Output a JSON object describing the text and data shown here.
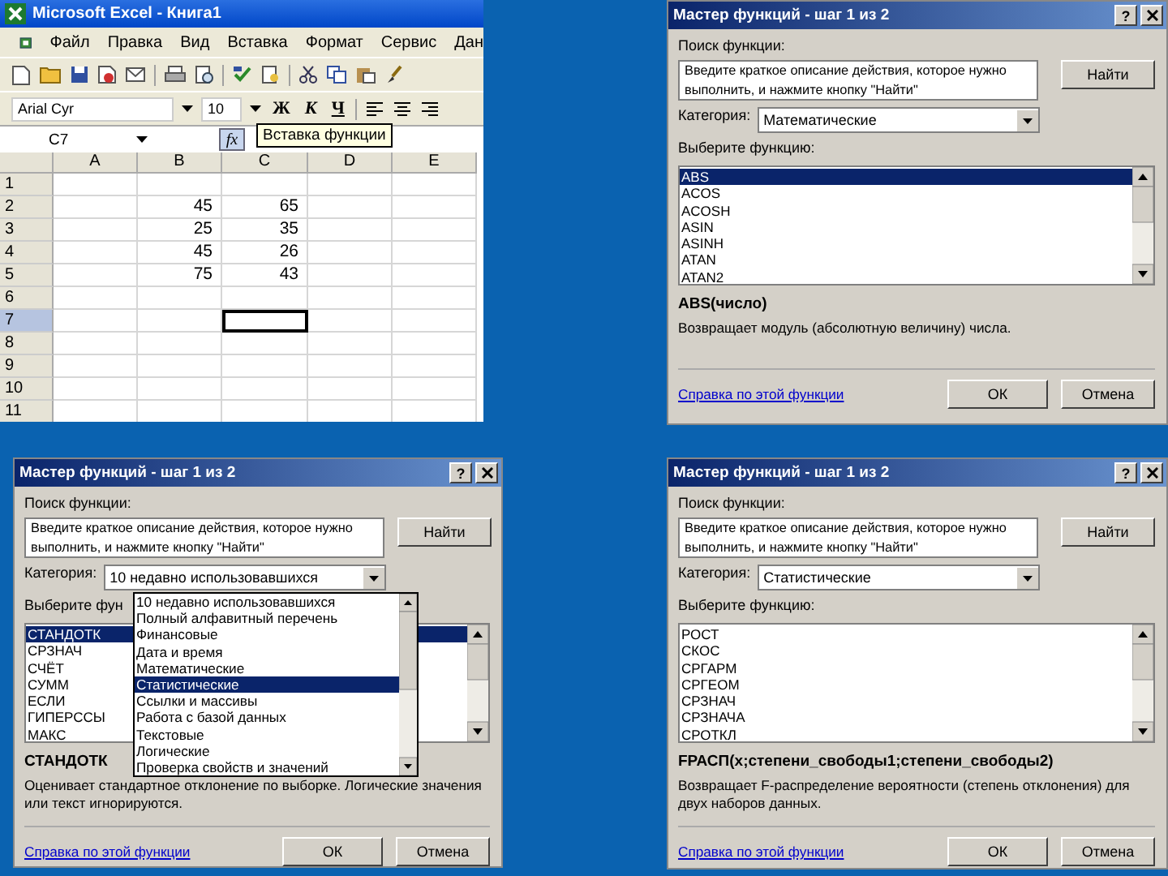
{
  "excel": {
    "title": "Microsoft Excel - Книга1",
    "menu": [
      "Файл",
      "Правка",
      "Вид",
      "Вставка",
      "Формат",
      "Сервис",
      "Дан"
    ],
    "font_name": "Arial Cyr",
    "font_size": "10",
    "format_buttons": [
      {
        "label": "Ж",
        "kind": "bold"
      },
      {
        "label": "К",
        "kind": "italic"
      },
      {
        "label": "Ч",
        "kind": "underline"
      }
    ],
    "name_box": "C7",
    "fx_button": "fx",
    "tooltip": "Вставка функции",
    "columns": [
      "A",
      "B",
      "C",
      "D",
      "E"
    ],
    "rows": [
      {
        "label": "1",
        "selected": false,
        "cells": [
          {
            "selected": false
          },
          {
            "selected": false
          },
          {
            "selected": false
          },
          {
            "selected": false
          },
          {
            "selected": false
          }
        ]
      },
      {
        "label": "2",
        "selected": false,
        "cells": [
          {
            "selected": false
          },
          {
            "text": "45",
            "selected": false
          },
          {
            "text": "65",
            "selected": false
          },
          {
            "selected": false
          },
          {
            "selected": false
          }
        ]
      },
      {
        "label": "3",
        "selected": false,
        "cells": [
          {
            "selected": false
          },
          {
            "text": "25",
            "selected": false
          },
          {
            "text": "35",
            "selected": false
          },
          {
            "selected": false
          },
          {
            "selected": false
          }
        ]
      },
      {
        "label": "4",
        "selected": false,
        "cells": [
          {
            "selected": false
          },
          {
            "text": "45",
            "selected": false
          },
          {
            "text": "26",
            "selected": false
          },
          {
            "selected": false
          },
          {
            "selected": false
          }
        ]
      },
      {
        "label": "5",
        "selected": false,
        "cells": [
          {
            "selected": false
          },
          {
            "text": "75",
            "selected": false
          },
          {
            "text": "43",
            "selected": false
          },
          {
            "selected": false
          },
          {
            "selected": false
          }
        ]
      },
      {
        "label": "6",
        "selected": false,
        "cells": [
          {
            "selected": false
          },
          {
            "selected": false
          },
          {
            "selected": false
          },
          {
            "selected": false
          },
          {
            "selected": false
          }
        ]
      },
      {
        "label": "7",
        "selected": true,
        "cells": [
          {
            "selected": false
          },
          {
            "selected": false
          },
          {
            "selected": true
          },
          {
            "selected": false
          },
          {
            "selected": false
          }
        ]
      },
      {
        "label": "8",
        "selected": false,
        "cells": [
          {
            "selected": false
          },
          {
            "selected": false
          },
          {
            "selected": false
          },
          {
            "selected": false
          },
          {
            "selected": false
          }
        ]
      },
      {
        "label": "9",
        "selected": false,
        "cells": [
          {
            "selected": false
          },
          {
            "selected": false
          },
          {
            "selected": false
          },
          {
            "selected": false
          },
          {
            "selected": false
          }
        ]
      },
      {
        "label": "10",
        "selected": false,
        "cells": [
          {
            "selected": false
          },
          {
            "selected": false
          },
          {
            "selected": false
          },
          {
            "selected": false
          },
          {
            "selected": false
          }
        ]
      },
      {
        "label": "11",
        "selected": false,
        "cells": [
          {
            "selected": false
          },
          {
            "selected": false
          },
          {
            "selected": false
          },
          {
            "selected": false
          },
          {
            "selected": false
          }
        ]
      }
    ]
  },
  "dialogs": [
    {
      "title": "Мастер функций - шаг 1 из 2",
      "help_button": "?",
      "search_label": "Поиск функции:",
      "search_text": "Введите краткое описание действия, которое нужно выполнить, и нажмите кнопку \"Найти\"",
      "find_button": "Найти",
      "category_label": "Категория:",
      "category_value": "Математические",
      "list_label": "Выберите функцию:",
      "functions": [
        {
          "name": "ABS",
          "selected": true
        },
        {
          "name": "ACOS",
          "selected": false
        },
        {
          "name": "ACOSH",
          "selected": false
        },
        {
          "name": "ASIN",
          "selected": false
        },
        {
          "name": "ASINH",
          "selected": false
        },
        {
          "name": "ATAN",
          "selected": false
        },
        {
          "name": "ATAN2",
          "selected": false
        }
      ],
      "signature": "ABS(число)",
      "description": "Возвращает модуль (абсолютную величину) числа.",
      "help_link": "Справка по этой функции",
      "ok_button": "ОК",
      "cancel_button": "Отмена"
    },
    {
      "title": "Мастер функций - шаг 1 из 2",
      "help_button": "?",
      "search_label": "Поиск функции:",
      "search_text": "Введите краткое описание действия, которое нужно выполнить, и нажмите кнопку \"Найти\"",
      "find_button": "Найти",
      "category_label": "Категория:",
      "category_value": "10 недавно использовавшихся",
      "list_label": "Выберите фун",
      "functions": [
        {
          "name": "СТАНДОТК",
          "selected": true
        },
        {
          "name": "СРЗНАЧ",
          "selected": false
        },
        {
          "name": "СЧЁТ",
          "selected": false
        },
        {
          "name": "СУММ",
          "selected": false
        },
        {
          "name": "ЕСЛИ",
          "selected": false
        },
        {
          "name": "ГИПЕРССЫ",
          "selected": false
        },
        {
          "name": "МАКС",
          "selected": false
        }
      ],
      "signature": "СТАНДОТК",
      "description": "Оценивает стандартное отклонение по выборке. Логические значения или текст игнорируются.",
      "help_link": "Справка по этой функции",
      "ok_button": "ОК",
      "cancel_button": "Отмена",
      "dropdown": [
        {
          "label": "10 недавно использовавшихся",
          "selected": false
        },
        {
          "label": "Полный алфавитный перечень",
          "selected": false
        },
        {
          "label": "Финансовые",
          "selected": false
        },
        {
          "label": "Дата и время",
          "selected": false
        },
        {
          "label": "Математические",
          "selected": false
        },
        {
          "label": "Статистические",
          "selected": true
        },
        {
          "label": "Ссылки и массивы",
          "selected": false
        },
        {
          "label": "Работа с базой данных",
          "selected": false
        },
        {
          "label": "Текстовые",
          "selected": false
        },
        {
          "label": "Логические",
          "selected": false
        },
        {
          "label": "Проверка свойств и значений",
          "selected": false
        }
      ]
    },
    {
      "title": "Мастер функций - шаг 1 из 2",
      "help_button": "?",
      "search_label": "Поиск функции:",
      "search_text": "Введите краткое описание действия, которое нужно выполнить, и нажмите кнопку \"Найти\"",
      "find_button": "Найти",
      "category_label": "Категория:",
      "category_value": "Статистические",
      "list_label": "Выберите функцию:",
      "functions": [
        {
          "name": "РОСТ",
          "selected": false
        },
        {
          "name": "СКОС",
          "selected": false
        },
        {
          "name": "СРГАРМ",
          "selected": false
        },
        {
          "name": "СРГЕОМ",
          "selected": false
        },
        {
          "name": "СРЗНАЧ",
          "selected": false
        },
        {
          "name": "СРЗНАЧА",
          "selected": false
        },
        {
          "name": "СРОТКЛ",
          "selected": false
        }
      ],
      "signature": "FРАСП(x;степени_свободы1;степени_свободы2)",
      "description": "Возвращает F-распределение вероятности (степень отклонения) для двух наборов данных.",
      "help_link": "Справка по этой функции",
      "ok_button": "ОК",
      "cancel_button": "Отмена"
    }
  ]
}
